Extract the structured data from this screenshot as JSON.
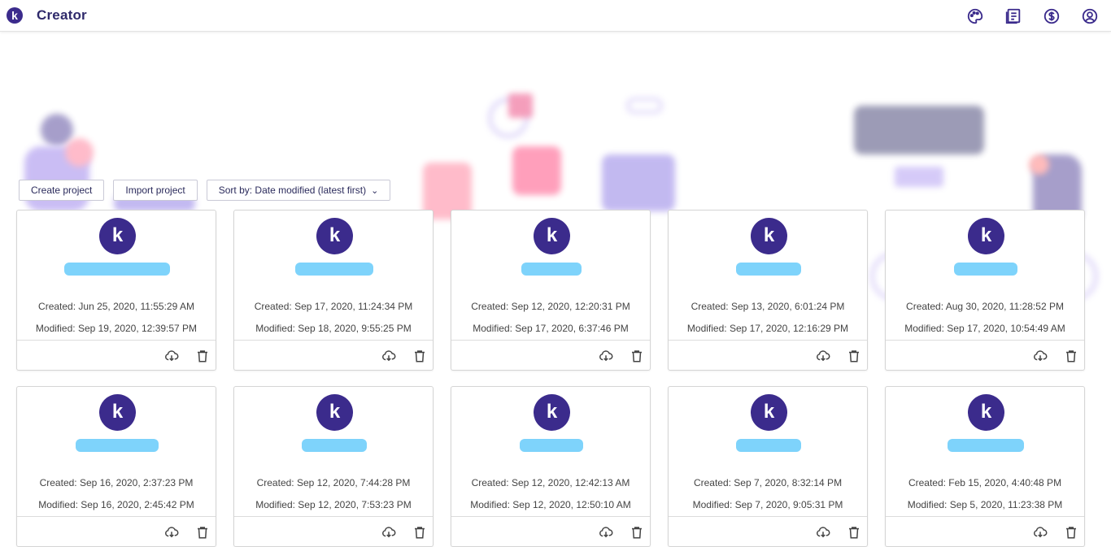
{
  "app": {
    "logo_letter": "k",
    "title": "Creator"
  },
  "header_icons": [
    "palette-icon",
    "document-list-icon",
    "dollar-icon",
    "account-icon"
  ],
  "toolbar": {
    "create_label": "Create project",
    "import_label": "Import project",
    "sort_label": "Sort by: Date modified (latest first)"
  },
  "colors": {
    "brand": "#3b2b8c",
    "redacted_name": "#7ed3fb"
  },
  "projects": [
    {
      "created": "Created: Jun 25, 2020, 11:55:29 AM",
      "modified": "Modified: Sep 19, 2020, 12:39:57 PM"
    },
    {
      "created": "Created: Sep 17, 2020, 11:24:34 PM",
      "modified": "Modified: Sep 18, 2020, 9:55:25 PM"
    },
    {
      "created": "Created: Sep 12, 2020, 12:20:31 PM",
      "modified": "Modified: Sep 17, 2020, 6:37:46 PM"
    },
    {
      "created": "Created: Sep 13, 2020, 6:01:24 PM",
      "modified": "Modified: Sep 17, 2020, 12:16:29 PM"
    },
    {
      "created": "Created: Aug 30, 2020, 11:28:52 PM",
      "modified": "Modified: Sep 17, 2020, 10:54:49 AM"
    },
    {
      "created": "Created: Sep 16, 2020, 2:37:23 PM",
      "modified": "Modified: Sep 16, 2020, 2:45:42 PM"
    },
    {
      "created": "Created: Sep 12, 2020, 7:44:28 PM",
      "modified": "Modified: Sep 12, 2020, 7:53:23 PM"
    },
    {
      "created": "Created: Sep 12, 2020, 12:42:13 AM",
      "modified": "Modified: Sep 12, 2020, 12:50:10 AM"
    },
    {
      "created": "Created: Sep 7, 2020, 8:32:14 PM",
      "modified": "Modified: Sep 7, 2020, 9:05:31 PM"
    },
    {
      "created": "Created: Feb 15, 2020, 4:40:48 PM",
      "modified": "Modified: Sep 5, 2020, 11:23:38 PM"
    }
  ]
}
